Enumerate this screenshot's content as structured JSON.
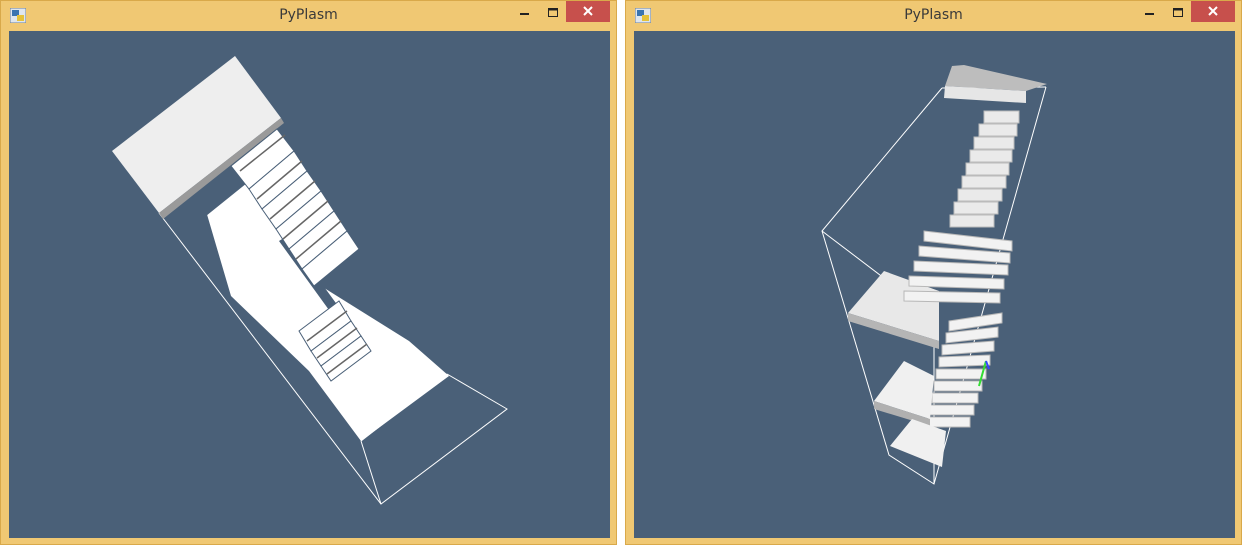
{
  "windows": [
    {
      "title": "PyPlasm",
      "icon": "python-icon",
      "viewport_background": "#4a6078",
      "model_color": "#ffffff",
      "bbox_color": "#ffffff"
    },
    {
      "title": "PyPlasm",
      "icon": "python-icon",
      "viewport_background": "#4a6078",
      "model_color": "#f2f2f2",
      "bbox_color": "#ffffff"
    }
  ],
  "controls": {
    "minimize": "minimize-icon",
    "maximize": "maximize-icon",
    "close": "close-icon"
  },
  "colors": {
    "frame": "#f0c873",
    "close_button": "#c7504c"
  }
}
